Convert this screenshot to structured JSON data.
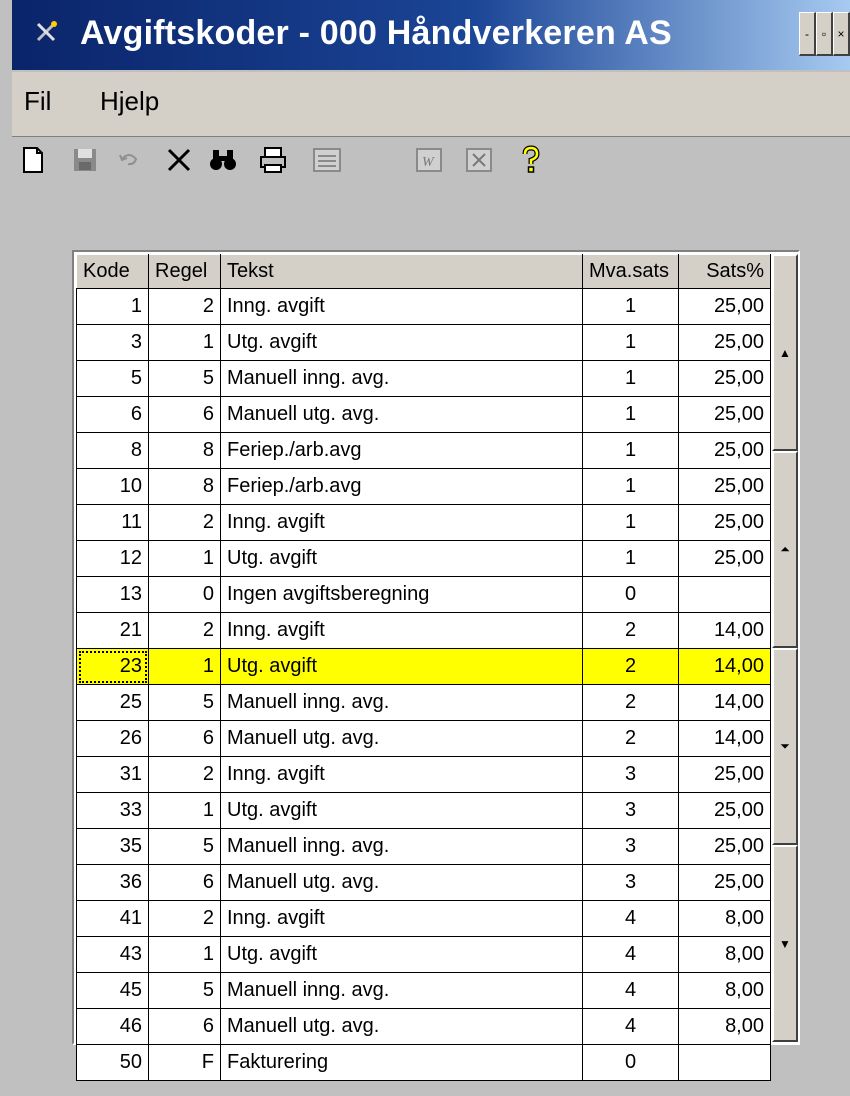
{
  "window": {
    "title": "Avgiftskoder - 000 Håndverkeren AS",
    "buttons": {
      "minimize": "-",
      "restore": "▫",
      "close": "×"
    }
  },
  "menu": {
    "items": [
      "Fil",
      "Hjelp"
    ]
  },
  "toolbar": {
    "icons": [
      "new-document",
      "save",
      "undo",
      "delete",
      "find",
      "print",
      "form",
      "word-export",
      "excel-export",
      "help"
    ]
  },
  "grid": {
    "columns": [
      "Kode",
      "Regel",
      "Tekst",
      "Mva.sats",
      "Sats%"
    ],
    "selected_index": 10,
    "selected_color": "#ffff00",
    "rows": [
      [
        "1",
        "2",
        "Inng. avgift",
        "1",
        "25,00"
      ],
      [
        "3",
        "1",
        "Utg. avgift",
        "1",
        "25,00"
      ],
      [
        "5",
        "5",
        "Manuell inng. avg.",
        "1",
        "25,00"
      ],
      [
        "6",
        "6",
        "Manuell utg. avg.",
        "1",
        "25,00"
      ],
      [
        "8",
        "8",
        "Feriep./arb.avg",
        "1",
        "25,00"
      ],
      [
        "10",
        "8",
        "Feriep./arb.avg",
        "1",
        "25,00"
      ],
      [
        "11",
        "2",
        "Inng. avgift",
        "1",
        "25,00"
      ],
      [
        "12",
        "1",
        "Utg. avgift",
        "1",
        "25,00"
      ],
      [
        "13",
        "0",
        "Ingen avgiftsberegning",
        "0",
        ""
      ],
      [
        "21",
        "2",
        "Inng. avgift",
        "2",
        "14,00"
      ],
      [
        "23",
        "1",
        "Utg. avgift",
        "2",
        "14,00"
      ],
      [
        "25",
        "5",
        "Manuell inng. avg.",
        "2",
        "14,00"
      ],
      [
        "26",
        "6",
        "Manuell utg. avg.",
        "2",
        "14,00"
      ],
      [
        "31",
        "2",
        "Inng. avgift",
        "3",
        "25,00"
      ],
      [
        "33",
        "1",
        "Utg. avgift",
        "3",
        "25,00"
      ],
      [
        "35",
        "5",
        "Manuell inng. avg.",
        "3",
        "25,00"
      ],
      [
        "36",
        "6",
        "Manuell utg. avg.",
        "3",
        "25,00"
      ],
      [
        "41",
        "2",
        "Inng. avgift",
        "4",
        "8,00"
      ],
      [
        "43",
        "1",
        "Utg. avgift",
        "4",
        "8,00"
      ],
      [
        "45",
        "5",
        "Manuell inng. avg.",
        "4",
        "8,00"
      ],
      [
        "46",
        "6",
        "Manuell utg. avg.",
        "4",
        "8,00"
      ],
      [
        "50",
        "F",
        "Fakturering",
        "0",
        ""
      ]
    ]
  },
  "scroll_buttons": [
    {
      "name": "scroll-top-button",
      "glyph": "▲"
    },
    {
      "name": "page-up-button",
      "glyph": "⏶"
    },
    {
      "name": "page-down-button",
      "glyph": "⏷"
    },
    {
      "name": "scroll-bottom-button",
      "glyph": "▼"
    }
  ]
}
